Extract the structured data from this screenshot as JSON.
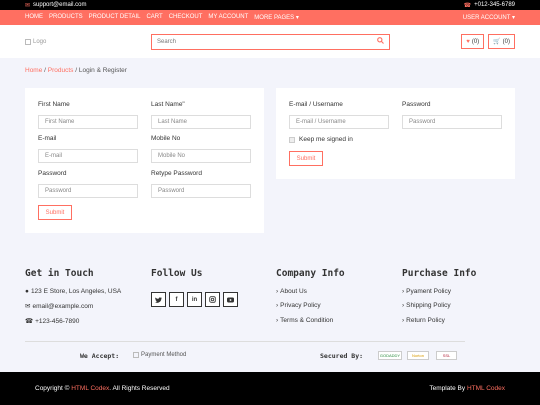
{
  "topbar": {
    "email": "support@email.com",
    "phone": "+012-345-6789"
  },
  "nav": {
    "links": [
      "HOME",
      "PRODUCTS",
      "PRODUCT DETAIL",
      "CART",
      "CHECKOUT",
      "MY ACCOUNT"
    ],
    "more": "MORE PAGES ▾",
    "user_account": "USER ACCOUNT ▾"
  },
  "header": {
    "logo_alt": "Logo",
    "search_placeholder": "Search",
    "wishlist_count": "(0)",
    "cart_count": "(0)"
  },
  "breadcrumb": {
    "home": "Home",
    "products": "Products",
    "current": "Login & Register",
    "sep": "/"
  },
  "register": {
    "first_name_label": "First Name",
    "first_name_placeholder": "First Name",
    "last_name_label": "Last Name\"",
    "last_name_placeholder": "Last Name",
    "email_label": "E-mail",
    "email_placeholder": "E-mail",
    "mobile_label": "Mobile No",
    "mobile_placeholder": "Mobile No",
    "password_label": "Password",
    "password_placeholder": "Password",
    "retype_label": "Retype Password",
    "retype_placeholder": "Password",
    "submit": "Submit"
  },
  "login": {
    "email_label": "E-mail / Username",
    "email_placeholder": "E-mail / Username",
    "password_label": "Password",
    "password_placeholder": "Password",
    "remember": "Keep me signed in",
    "submit": "Submit"
  },
  "footer": {
    "get_in_touch": {
      "title": "Get in Touch",
      "address": "123 E Store, Los Angeles, USA",
      "email": "email@example.com",
      "phone": "+123-456-7890"
    },
    "follow_us": {
      "title": "Follow Us",
      "icons": [
        "twitter-icon",
        "facebook-icon",
        "linkedin-icon",
        "instagram-icon",
        "youtube-icon"
      ]
    },
    "company_info": {
      "title": "Company Info",
      "items": [
        "About Us",
        "Privacy Policy",
        "Terms & Condition"
      ]
    },
    "purchase_info": {
      "title": "Purchase Info",
      "items": [
        "Pyament Policy",
        "Shipping Policy",
        "Return Policy"
      ]
    },
    "we_accept": "We Accept:",
    "payment_alt": "Payment Method",
    "secured_by": "Secured By:",
    "badges": [
      "GODADDY",
      "Norton",
      "SSL"
    ]
  },
  "copyright": {
    "prefix": "Copyright ©",
    "brand": "HTML Codex",
    "suffix": ". All Rights Reserved",
    "template_by": "Template By",
    "template_brand": "HTML Codex"
  },
  "colors": {
    "accent": "#ff6f61",
    "dark": "#000000",
    "panel_bg": "#f3f4fb"
  }
}
